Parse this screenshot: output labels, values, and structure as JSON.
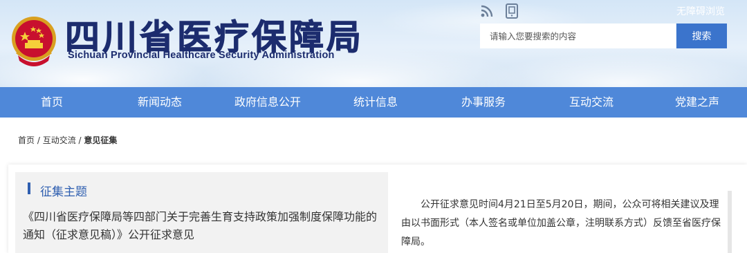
{
  "header": {
    "title": "四川省医疗保障局",
    "subtitle": "Sichuan Provincial Healthcare Security Administration",
    "accessibility_link": "无障碍浏览",
    "icons": [
      "emblem-icon",
      "rss-icon",
      "mobile-icon"
    ],
    "search": {
      "placeholder": "请输入您要搜索的内容",
      "value": "",
      "button_label": "搜索"
    }
  },
  "nav": {
    "items": [
      {
        "label": "首页"
      },
      {
        "label": "新闻动态"
      },
      {
        "label": "政府信息公开"
      },
      {
        "label": "统计信息"
      },
      {
        "label": "办事服务"
      },
      {
        "label": "互动交流"
      },
      {
        "label": "党建之声"
      }
    ]
  },
  "breadcrumb": {
    "home": "首页",
    "sep1": " / ",
    "section": "互动交流",
    "sep2": " / ",
    "current": "意见征集"
  },
  "content": {
    "topic_heading": "征集主题",
    "topic_text": "《四川省医疗保障局等四部门关于完善生育支持政策加强制度保障功能的通知（征求意见稿）》公开征求意见",
    "notice_text": "公开征求意见时间4月21日至5月20日，期间，公众可将相关建议及理由以书面形式（本人签名或单位加盖公章，注明联系方式）反馈至省医疗保障局。"
  },
  "colors": {
    "nav_bg": "#4f88d9",
    "search_button": "#3b74cc",
    "title": "#1c2c6e",
    "accent": "#2f5fb0"
  }
}
